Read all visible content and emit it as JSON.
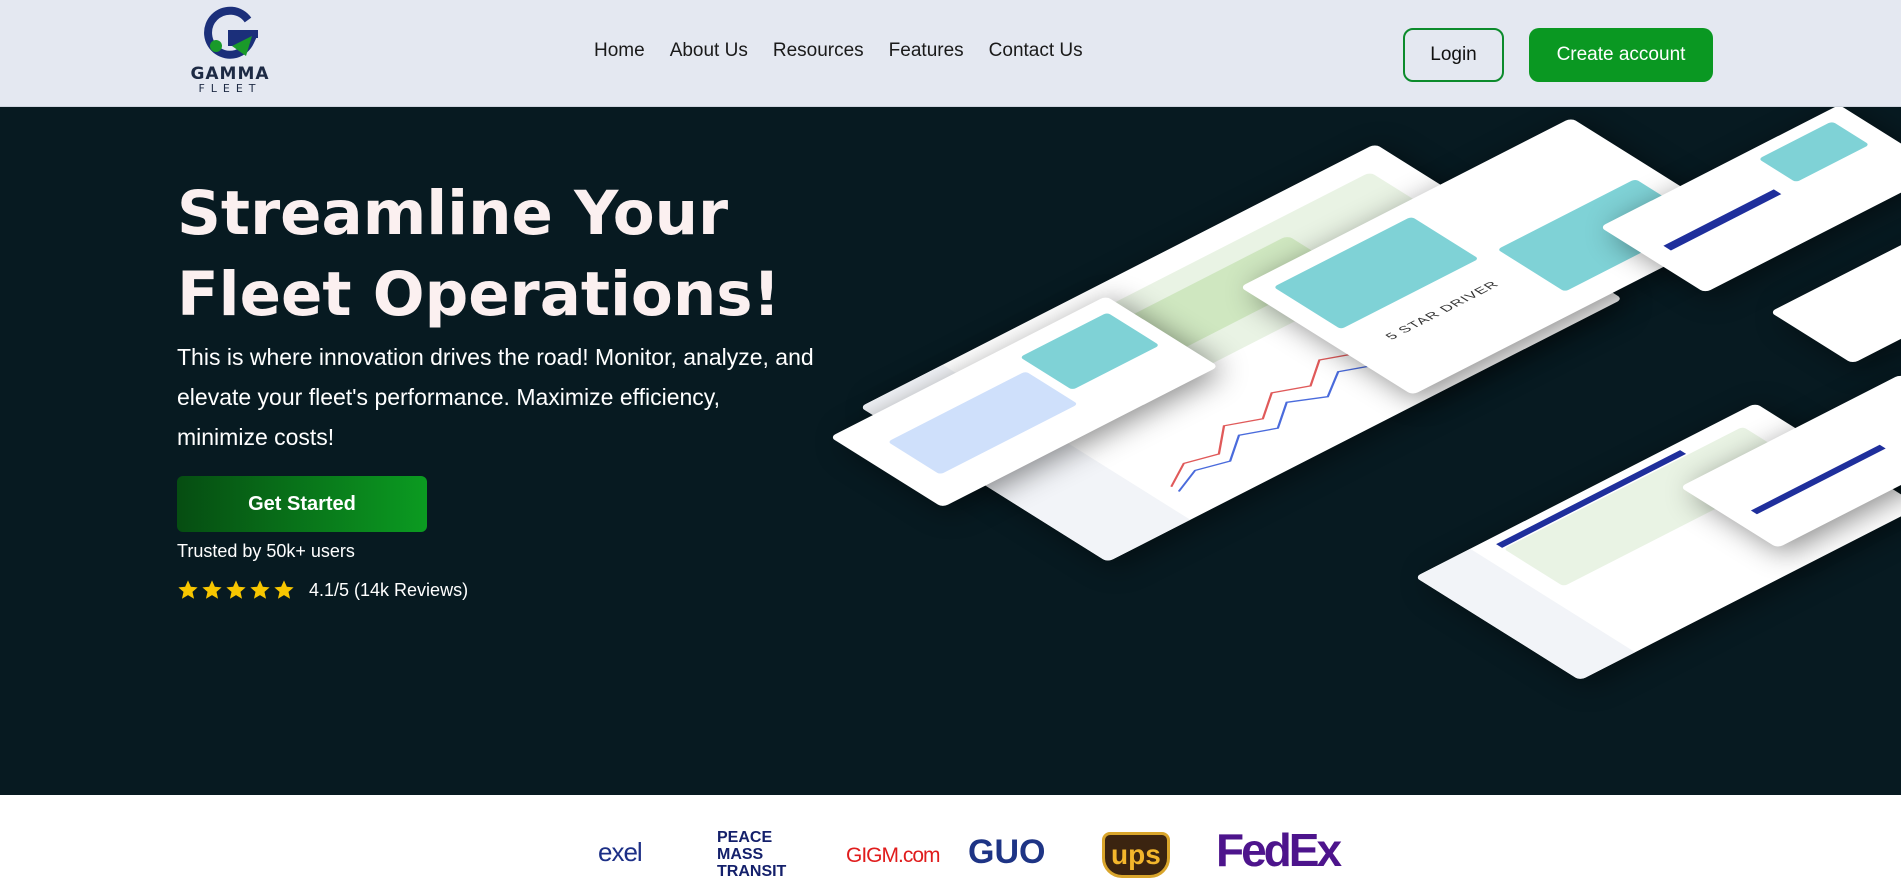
{
  "brand": {
    "name": "GAMMA",
    "sub": "FLEET"
  },
  "nav": {
    "items": [
      "Home",
      "About Us",
      "Resources",
      "Features",
      "Contact Us"
    ],
    "login": "Login",
    "create_account": "Create account"
  },
  "hero": {
    "title_line1": "Streamline Your",
    "title_line2": "Fleet Operations!",
    "lead": "This is where innovation drives the road! Monitor, analyze, and elevate your fleet's performance. Maximize efficiency, minimize costs!",
    "cta": "Get Started",
    "trusted": "Trusted by 50k+ users",
    "rating": "4.1/5 (14k Reviews)",
    "stars": 5,
    "mock_driver_label": "5 STAR DRIVER"
  },
  "partners": [
    "exel",
    "PEACE MASS TRANSIT",
    "GIGM.com",
    "GUO",
    "ups",
    "FedEx"
  ],
  "colors": {
    "accent": "#0a9822",
    "hero_bg": "#071a21",
    "nav_bg": "#e4e8f1",
    "star": "#f7c600"
  }
}
